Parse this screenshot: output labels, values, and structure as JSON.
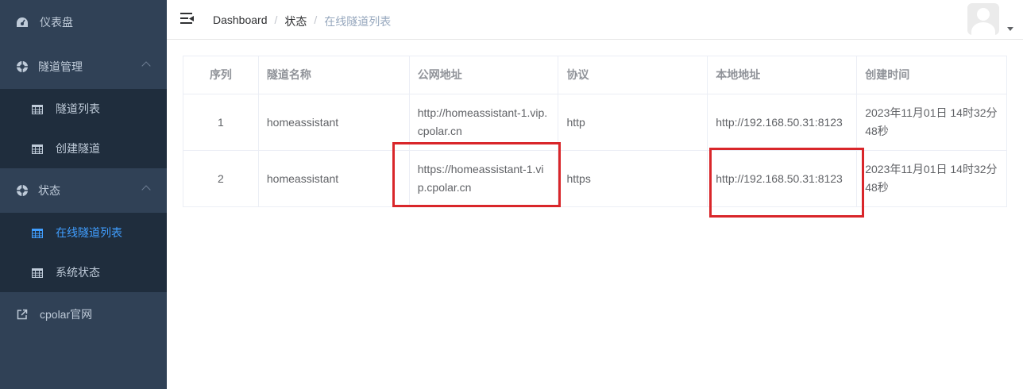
{
  "sidebar": {
    "dashboard": "仪表盘",
    "tunnel_mgmt": "隧道管理",
    "tunnel_list": "隧道列表",
    "create_tunnel": "创建隧道",
    "status": "状态",
    "online_tunnels": "在线隧道列表",
    "system_status": "系统状态",
    "official_site": "cpolar官网"
  },
  "header": {
    "breadcrumb": [
      "Dashboard",
      "状态",
      "在线隧道列表"
    ],
    "separator": "/"
  },
  "table": {
    "headers": [
      "序列",
      "隧道名称",
      "公网地址",
      "协议",
      "本地地址",
      "创建时间"
    ],
    "rows": [
      [
        "1",
        "homeassistant",
        "http://homeassistant-1.vip.cpolar.cn",
        "http",
        "http://192.168.50.31:8123",
        "2023年11月01日 14时32分48秒"
      ],
      [
        "2",
        "homeassistant",
        "https://homeassistant-1.vip.cpolar.cn",
        "https",
        "http://192.168.50.31:8123",
        "2023年11月01日 14时32分48秒"
      ]
    ]
  },
  "colors": {
    "sidebar_bg": "#304156",
    "submenu_bg": "#1f2d3d",
    "active": "#409eff",
    "highlight": "#d9262a"
  },
  "icons": [
    "dashboard-icon",
    "lifebuoy-icon",
    "table-icon",
    "external-link-icon",
    "hamburger-icon",
    "avatar-icon",
    "caret-down-icon"
  ]
}
